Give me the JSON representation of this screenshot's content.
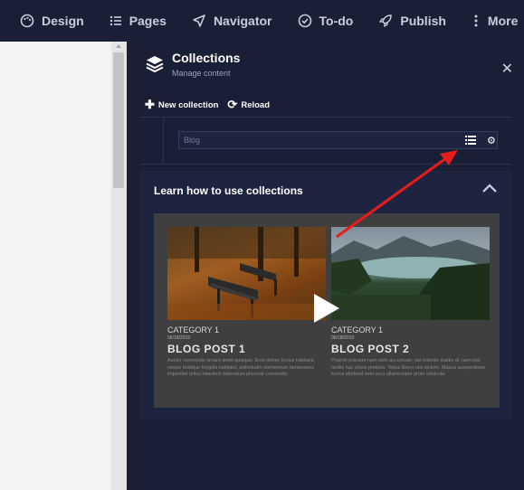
{
  "nav": {
    "items": [
      {
        "label": "Design",
        "icon": "palette-icon"
      },
      {
        "label": "Pages",
        "icon": "list-icon"
      },
      {
        "label": "Navigator",
        "icon": "navigation-arrow-icon"
      },
      {
        "label": "To-do",
        "icon": "check-circle-icon"
      },
      {
        "label": "Publish",
        "icon": "rocket-icon"
      },
      {
        "label": "More",
        "icon": "vertical-dots-icon"
      }
    ]
  },
  "panel": {
    "title": "Collections",
    "subtitle": "Manage content",
    "new_collection_label": "New collection",
    "reload_label": "Reload",
    "collection_name": "Blog"
  },
  "learn": {
    "title": "Learn how to use collections",
    "posts": [
      {
        "category": "CATEGORY 1",
        "date": "06/18/2019",
        "title": "BLOG POST 1",
        "excerpt": "Auctor commodo ornare amet quisque. Eros donec lectus habitant, neque tristique fringilla habitant, sollicitudin elementum tamenaeos imperdiet tellus interdum bibendum placerat commodo."
      },
      {
        "category": "CATEGORY 1",
        "date": "06/18/2019",
        "title": "BLOG POST 2",
        "excerpt": "Potenti posuere nam sem accumsan, est lobortis mattis id, nam nisl mollis hac etiam pretium. Tellus libero nisi dictum. Massa suspendisse luctus eleifend sem arcu ullamcorper proin vehicula."
      }
    ]
  },
  "colors": {
    "background": "#1a1f35",
    "panel_box": "#1e2440",
    "canvas": "#f3f3f3",
    "annotation_arrow": "#e81c1c"
  }
}
